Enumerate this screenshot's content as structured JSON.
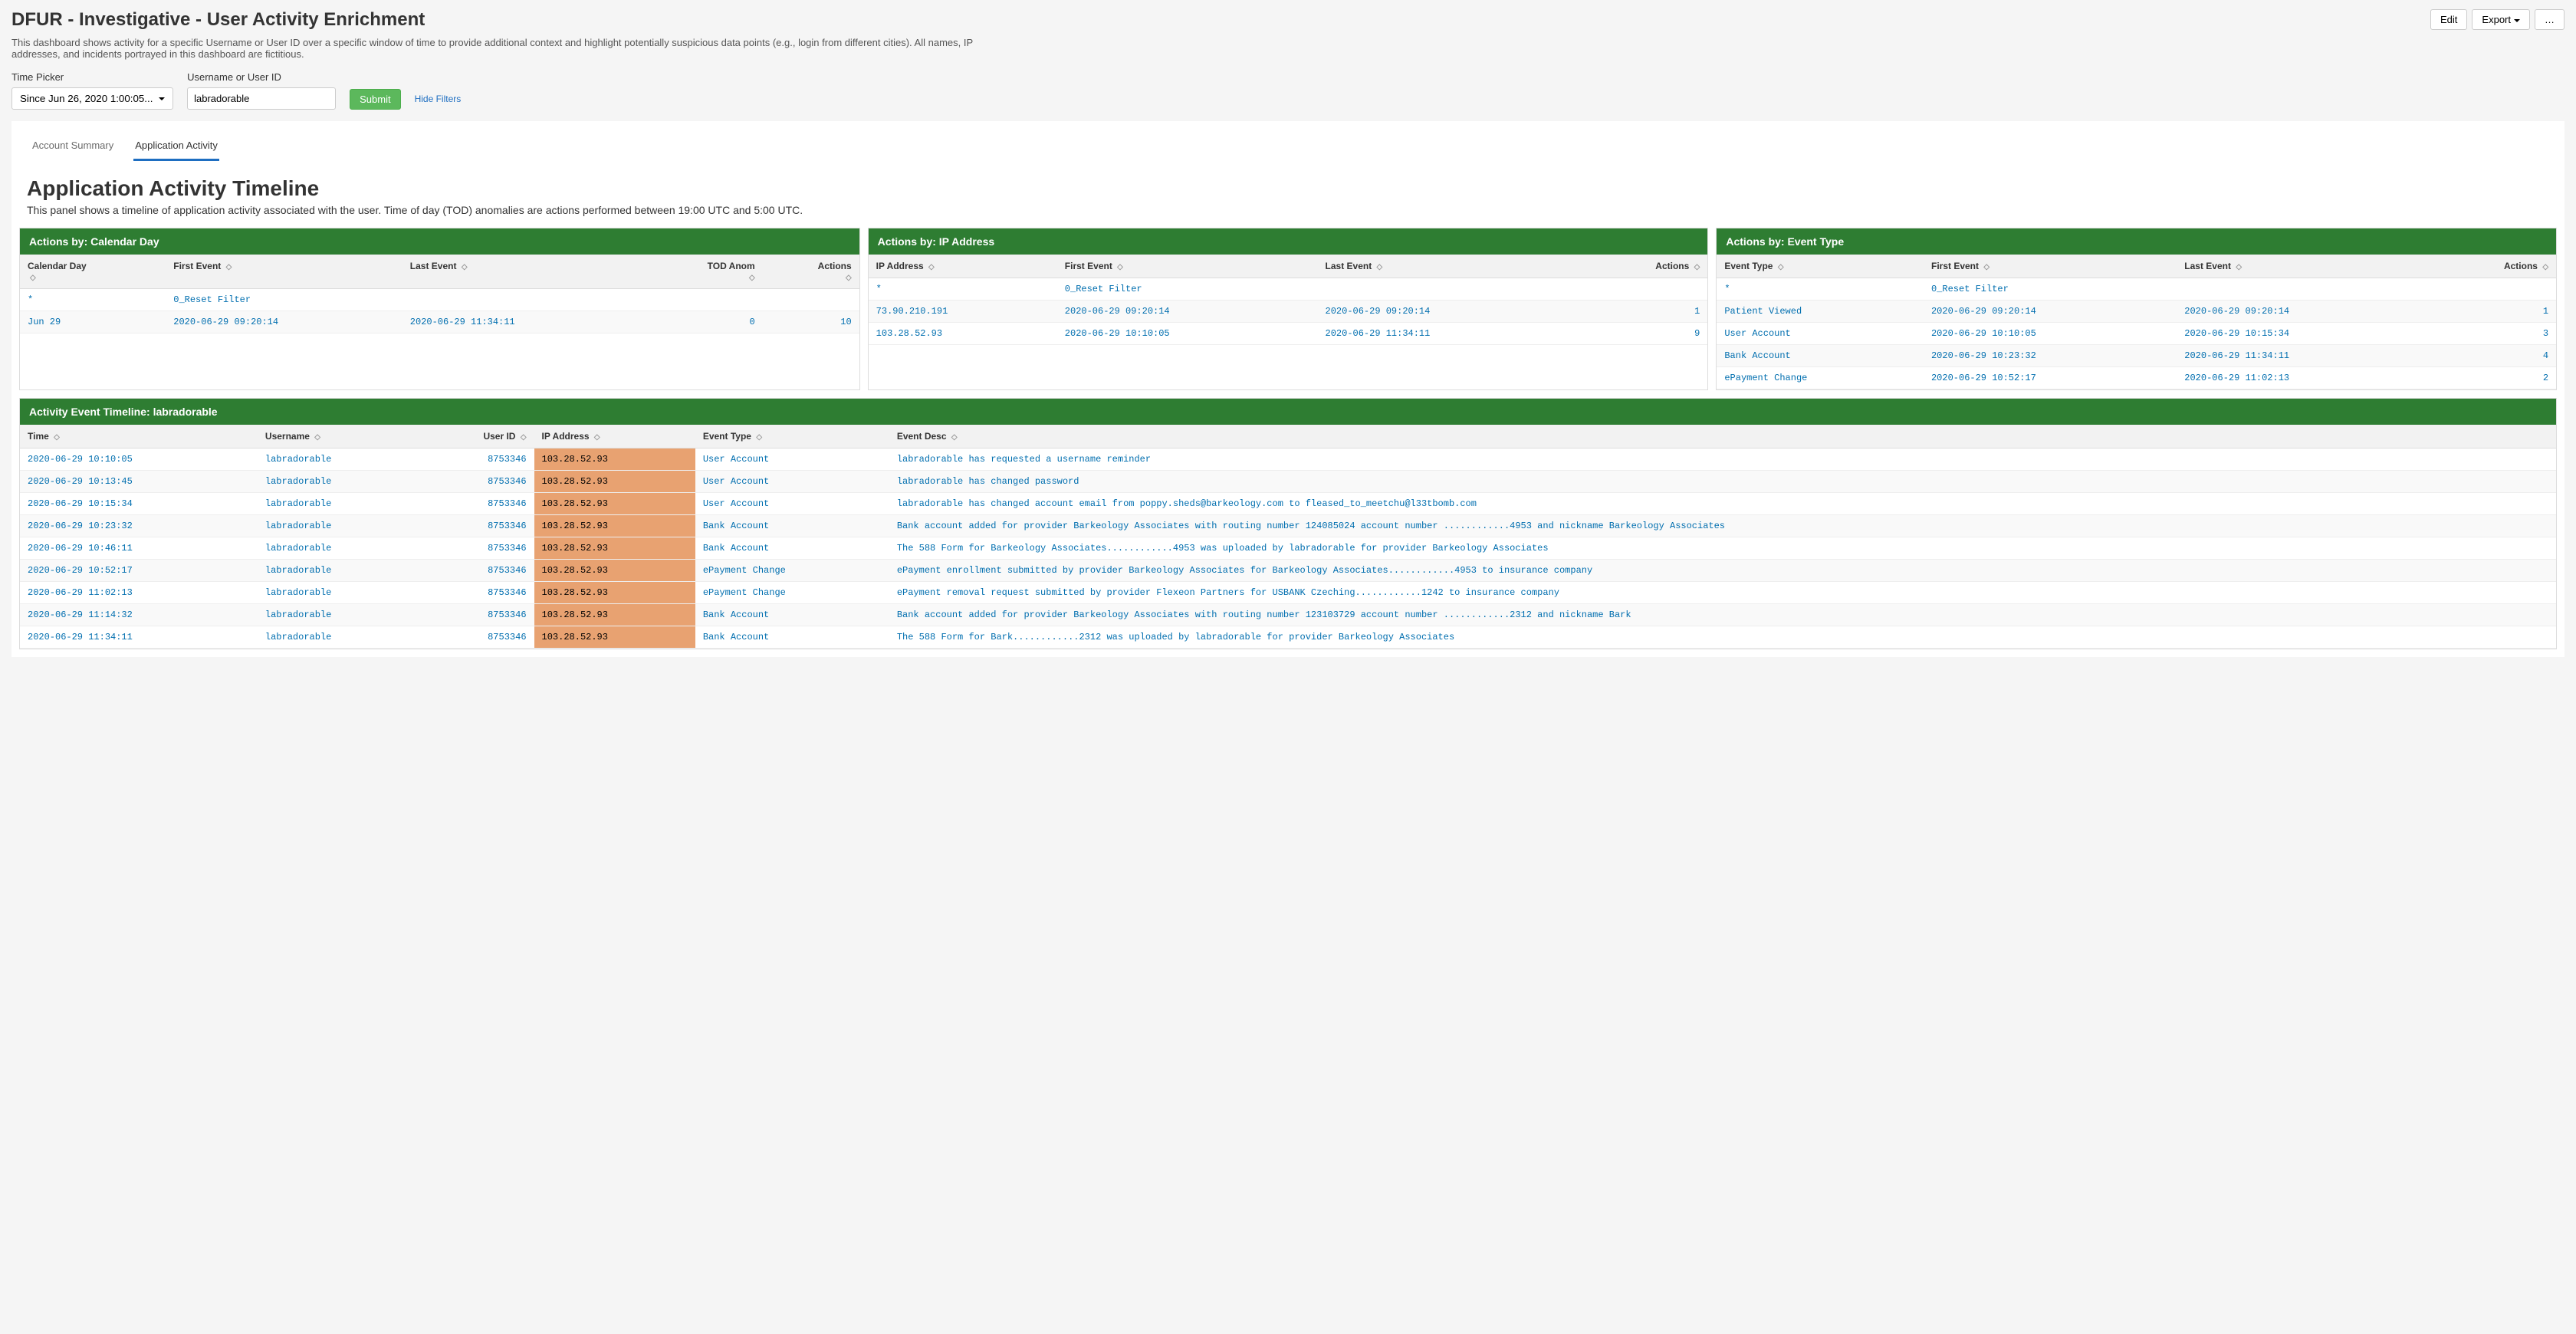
{
  "header": {
    "title": "DFUR - Investigative - User Activity Enrichment",
    "edit": "Edit",
    "export": "Export",
    "more": "…",
    "description": "This dashboard shows activity for a specific Username or User ID over a specific window of time to provide additional context and highlight potentially suspicious data points (e.g., login from different cities). All names, IP addresses, and incidents portrayed in this dashboard are fictitious."
  },
  "filters": {
    "time_label": "Time Picker",
    "time_value": "Since Jun 26, 2020 1:00:05...",
    "user_label": "Username or User ID",
    "user_value": "labradorable",
    "submit": "Submit",
    "hide": "Hide Filters"
  },
  "tabs": {
    "summary": "Account Summary",
    "activity": "Application Activity"
  },
  "section": {
    "title": "Application Activity Timeline",
    "desc": "This panel shows a timeline of application activity associated with the user. Time of day (TOD) anomalies are actions performed between 19:00 UTC and 5:00 UTC."
  },
  "panels": {
    "by_day": {
      "title": "Actions by: Calendar Day",
      "cols": {
        "c1": "Calendar Day",
        "c2": "First Event",
        "c3": "Last Event",
        "c4": "TOD Anom",
        "c5": "Actions"
      },
      "rows": [
        {
          "day": "*",
          "first": "0_Reset Filter",
          "last": "",
          "tod": "",
          "actions": ""
        },
        {
          "day": "Jun 29",
          "first": "2020-06-29 09:20:14",
          "last": "2020-06-29 11:34:11",
          "tod": "0",
          "actions": "10"
        }
      ]
    },
    "by_ip": {
      "title": "Actions by: IP Address",
      "cols": {
        "c1": "IP Address",
        "c2": "First Event",
        "c3": "Last Event",
        "c4": "Actions"
      },
      "rows": [
        {
          "ip": "*",
          "first": "0_Reset Filter",
          "last": "",
          "actions": ""
        },
        {
          "ip": "73.90.210.191",
          "first": "2020-06-29 09:20:14",
          "last": "2020-06-29 09:20:14",
          "actions": "1"
        },
        {
          "ip": "103.28.52.93",
          "first": "2020-06-29 10:10:05",
          "last": "2020-06-29 11:34:11",
          "actions": "9"
        }
      ]
    },
    "by_event": {
      "title": "Actions by: Event Type",
      "cols": {
        "c1": "Event Type",
        "c2": "First Event",
        "c3": "Last Event",
        "c4": "Actions"
      },
      "rows": [
        {
          "et": "*",
          "first": "0_Reset Filter",
          "last": "",
          "actions": ""
        },
        {
          "et": "Patient Viewed",
          "first": "2020-06-29 09:20:14",
          "last": "2020-06-29 09:20:14",
          "actions": "1"
        },
        {
          "et": "User Account",
          "first": "2020-06-29 10:10:05",
          "last": "2020-06-29 10:15:34",
          "actions": "3"
        },
        {
          "et": "Bank Account",
          "first": "2020-06-29 10:23:32",
          "last": "2020-06-29 11:34:11",
          "actions": "4"
        },
        {
          "et": "ePayment Change",
          "first": "2020-06-29 10:52:17",
          "last": "2020-06-29 11:02:13",
          "actions": "2"
        }
      ]
    }
  },
  "timeline": {
    "title": "Activity Event Timeline: labradorable",
    "cols": {
      "c1": "Time",
      "c2": "Username",
      "c3": "User ID",
      "c4": "IP Address",
      "c5": "Event Type",
      "c6": "Event Desc"
    },
    "rows": [
      {
        "time": "2020-06-29 10:10:05",
        "user": "labradorable",
        "uid": "8753346",
        "ip": "103.28.52.93",
        "et": "User Account",
        "desc": "labradorable has requested a username reminder"
      },
      {
        "time": "2020-06-29 10:13:45",
        "user": "labradorable",
        "uid": "8753346",
        "ip": "103.28.52.93",
        "et": "User Account",
        "desc": "labradorable has changed password"
      },
      {
        "time": "2020-06-29 10:15:34",
        "user": "labradorable",
        "uid": "8753346",
        "ip": "103.28.52.93",
        "et": "User Account",
        "desc": "labradorable has changed account email from poppy.sheds@barkeology.com to fleased_to_meetchu@l33tbomb.com"
      },
      {
        "time": "2020-06-29 10:23:32",
        "user": "labradorable",
        "uid": "8753346",
        "ip": "103.28.52.93",
        "et": "Bank Account",
        "desc": "Bank account added for provider Barkeology Associates with routing number 124085024 account number ............4953 and nickname Barkeology Associates"
      },
      {
        "time": "2020-06-29 10:46:11",
        "user": "labradorable",
        "uid": "8753346",
        "ip": "103.28.52.93",
        "et": "Bank Account",
        "desc": "The 588 Form for Barkeology Associates............4953 was uploaded by labradorable for provider Barkeology Associates"
      },
      {
        "time": "2020-06-29 10:52:17",
        "user": "labradorable",
        "uid": "8753346",
        "ip": "103.28.52.93",
        "et": "ePayment Change",
        "desc": "ePayment enrollment submitted by provider Barkeology Associates for Barkeology Associates............4953 to insurance company"
      },
      {
        "time": "2020-06-29 11:02:13",
        "user": "labradorable",
        "uid": "8753346",
        "ip": "103.28.52.93",
        "et": "ePayment Change",
        "desc": "ePayment removal request submitted by provider Flexeon Partners for USBANK Czeching............1242 to insurance company"
      },
      {
        "time": "2020-06-29 11:14:32",
        "user": "labradorable",
        "uid": "8753346",
        "ip": "103.28.52.93",
        "et": "Bank Account",
        "desc": "Bank account added for provider Barkeology Associates with routing number 123103729 account number ............2312 and nickname Bark"
      },
      {
        "time": "2020-06-29 11:34:11",
        "user": "labradorable",
        "uid": "8753346",
        "ip": "103.28.52.93",
        "et": "Bank Account",
        "desc": "The 588 Form for Bark............2312 was uploaded by labradorable for provider Barkeology Associates"
      }
    ]
  }
}
